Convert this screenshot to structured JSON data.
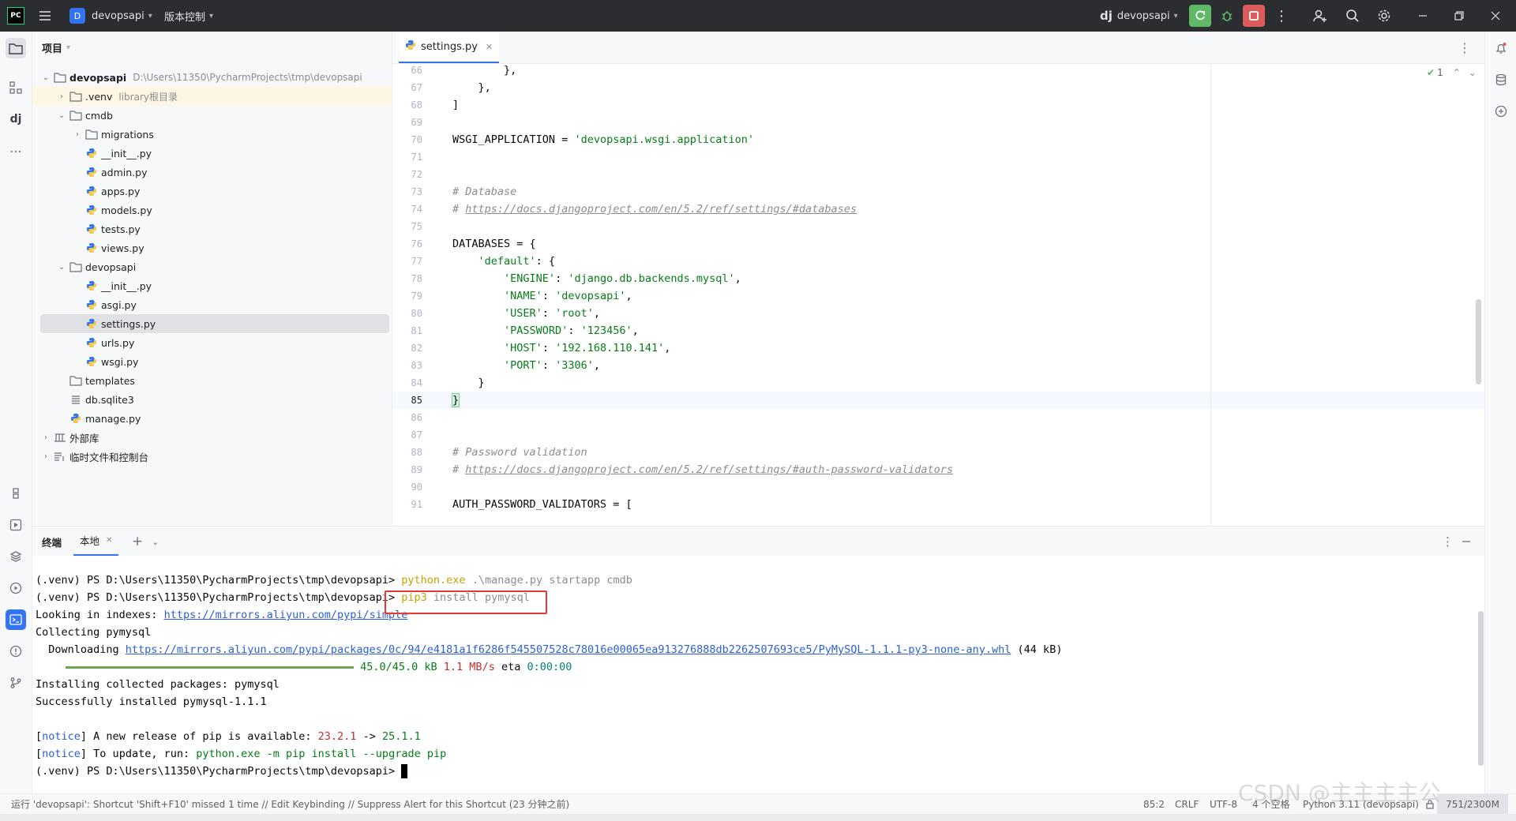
{
  "titlebar": {
    "app_icon": "PC",
    "project_badge": "D",
    "project_name": "devopsapi",
    "vcs_label": "版本控制",
    "run_config_logo": "dj",
    "run_config": "devopsapi"
  },
  "project_panel": {
    "title": "项目",
    "tree": [
      {
        "label": "devopsapi",
        "extra": "D:\\Users\\11350\\PycharmProjects\\tmp\\devopsapi",
        "icon": "folder-icon",
        "depth": 0,
        "arrow": "down",
        "bold": true
      },
      {
        "label": ".venv",
        "extra": "library根目录",
        "icon": "folder-icon",
        "depth": 1,
        "arrow": "right"
      },
      {
        "label": "cmdb",
        "extra": "",
        "icon": "folder-icon",
        "depth": 1,
        "arrow": "down"
      },
      {
        "label": "migrations",
        "extra": "",
        "icon": "folder-icon",
        "depth": 2,
        "arrow": "right"
      },
      {
        "label": "__init__.py",
        "extra": "",
        "icon": "python-file-icon",
        "depth": 2,
        "arrow": ""
      },
      {
        "label": "admin.py",
        "extra": "",
        "icon": "python-file-icon",
        "depth": 2,
        "arrow": ""
      },
      {
        "label": "apps.py",
        "extra": "",
        "icon": "python-file-icon",
        "depth": 2,
        "arrow": ""
      },
      {
        "label": "models.py",
        "extra": "",
        "icon": "python-file-icon",
        "depth": 2,
        "arrow": ""
      },
      {
        "label": "tests.py",
        "extra": "",
        "icon": "python-file-icon",
        "depth": 2,
        "arrow": ""
      },
      {
        "label": "views.py",
        "extra": "",
        "icon": "python-file-icon",
        "depth": 2,
        "arrow": ""
      },
      {
        "label": "devopsapi",
        "extra": "",
        "icon": "folder-icon",
        "depth": 1,
        "arrow": "down"
      },
      {
        "label": "__init__.py",
        "extra": "",
        "icon": "python-file-icon",
        "depth": 2,
        "arrow": ""
      },
      {
        "label": "asgi.py",
        "extra": "",
        "icon": "python-file-icon",
        "depth": 2,
        "arrow": ""
      },
      {
        "label": "settings.py",
        "extra": "",
        "icon": "python-file-icon",
        "depth": 2,
        "arrow": "",
        "selected": true
      },
      {
        "label": "urls.py",
        "extra": "",
        "icon": "python-file-icon",
        "depth": 2,
        "arrow": ""
      },
      {
        "label": "wsgi.py",
        "extra": "",
        "icon": "python-file-icon",
        "depth": 2,
        "arrow": ""
      },
      {
        "label": "templates",
        "extra": "",
        "icon": "folder-icon",
        "depth": 1,
        "arrow": ""
      },
      {
        "label": "db.sqlite3",
        "extra": "",
        "icon": "database-file-icon",
        "depth": 1,
        "arrow": ""
      },
      {
        "label": "manage.py",
        "extra": "",
        "icon": "python-file-icon",
        "depth": 1,
        "arrow": ""
      },
      {
        "label": "外部库",
        "extra": "",
        "icon": "library-icon",
        "depth": 0,
        "arrow": "right"
      },
      {
        "label": "临时文件和控制台",
        "extra": "",
        "icon": "scratches-icon",
        "depth": 0,
        "arrow": "right"
      }
    ]
  },
  "editor": {
    "tab_label": "settings.py",
    "inspection_count": "1",
    "lines": [
      {
        "n": "66",
        "parts": [
          {
            "t": "        },",
            "c": ""
          }
        ]
      },
      {
        "n": "67",
        "parts": [
          {
            "t": "    },",
            "c": ""
          }
        ]
      },
      {
        "n": "68",
        "parts": [
          {
            "t": "]",
            "c": ""
          }
        ]
      },
      {
        "n": "69",
        "parts": [
          {
            "t": "",
            "c": ""
          }
        ]
      },
      {
        "n": "70",
        "parts": [
          {
            "t": "WSGI_APPLICATION = ",
            "c": ""
          },
          {
            "t": "'devopsapi.wsgi.application'",
            "c": "str"
          }
        ]
      },
      {
        "n": "71",
        "parts": [
          {
            "t": "",
            "c": ""
          }
        ]
      },
      {
        "n": "72",
        "parts": [
          {
            "t": "",
            "c": ""
          }
        ]
      },
      {
        "n": "73",
        "parts": [
          {
            "t": "# Database",
            "c": "cmt"
          }
        ]
      },
      {
        "n": "74",
        "parts": [
          {
            "t": "# ",
            "c": "cmt"
          },
          {
            "t": "https://docs.djangoproject.com/en/5.2/ref/settings/#databases",
            "c": "lnk"
          }
        ]
      },
      {
        "n": "75",
        "parts": [
          {
            "t": "",
            "c": ""
          }
        ]
      },
      {
        "n": "76",
        "parts": [
          {
            "t": "DATABASES = {",
            "c": ""
          }
        ]
      },
      {
        "n": "77",
        "parts": [
          {
            "t": "    ",
            "c": ""
          },
          {
            "t": "'default'",
            "c": "str"
          },
          {
            "t": ": {",
            "c": ""
          }
        ]
      },
      {
        "n": "78",
        "parts": [
          {
            "t": "        ",
            "c": ""
          },
          {
            "t": "'ENGINE'",
            "c": "str"
          },
          {
            "t": ": ",
            "c": ""
          },
          {
            "t": "'django.db.backends.mysql'",
            "c": "str"
          },
          {
            "t": ",",
            "c": ""
          }
        ]
      },
      {
        "n": "79",
        "parts": [
          {
            "t": "        ",
            "c": ""
          },
          {
            "t": "'NAME'",
            "c": "str"
          },
          {
            "t": ": ",
            "c": ""
          },
          {
            "t": "'devopsapi'",
            "c": "str"
          },
          {
            "t": ",",
            "c": ""
          }
        ]
      },
      {
        "n": "80",
        "parts": [
          {
            "t": "        ",
            "c": ""
          },
          {
            "t": "'USER'",
            "c": "str"
          },
          {
            "t": ": ",
            "c": ""
          },
          {
            "t": "'root'",
            "c": "str"
          },
          {
            "t": ",",
            "c": ""
          }
        ]
      },
      {
        "n": "81",
        "parts": [
          {
            "t": "        ",
            "c": ""
          },
          {
            "t": "'PASSWORD'",
            "c": "str"
          },
          {
            "t": ": ",
            "c": ""
          },
          {
            "t": "'123456'",
            "c": "str"
          },
          {
            "t": ",",
            "c": ""
          }
        ]
      },
      {
        "n": "82",
        "parts": [
          {
            "t": "        ",
            "c": ""
          },
          {
            "t": "'HOST'",
            "c": "str"
          },
          {
            "t": ": ",
            "c": ""
          },
          {
            "t": "'192.168.110.141'",
            "c": "str"
          },
          {
            "t": ",",
            "c": ""
          }
        ]
      },
      {
        "n": "83",
        "parts": [
          {
            "t": "        ",
            "c": ""
          },
          {
            "t": "'PORT'",
            "c": "str"
          },
          {
            "t": ": ",
            "c": ""
          },
          {
            "t": "'3306'",
            "c": "str"
          },
          {
            "t": ",",
            "c": ""
          }
        ]
      },
      {
        "n": "84",
        "parts": [
          {
            "t": "    }",
            "c": ""
          }
        ]
      },
      {
        "n": "85",
        "parts": [
          {
            "t": "}",
            "c": ""
          }
        ],
        "current": true
      },
      {
        "n": "86",
        "parts": [
          {
            "t": "",
            "c": ""
          }
        ]
      },
      {
        "n": "87",
        "parts": [
          {
            "t": "",
            "c": ""
          }
        ]
      },
      {
        "n": "88",
        "parts": [
          {
            "t": "# Password validation",
            "c": "cmt"
          }
        ]
      },
      {
        "n": "89",
        "parts": [
          {
            "t": "# ",
            "c": "cmt"
          },
          {
            "t": "https://docs.djangoproject.com/en/5.2/ref/settings/#auth-password-validators",
            "c": "lnk"
          }
        ]
      },
      {
        "n": "90",
        "parts": [
          {
            "t": "",
            "c": ""
          }
        ]
      },
      {
        "n": "91",
        "parts": [
          {
            "t": "AUTH_PASSWORD_VALIDATORS = [",
            "c": ""
          }
        ]
      }
    ]
  },
  "terminal": {
    "tab_terminal": "终端",
    "tab_local": "本地",
    "lines": [
      {
        "parts": [
          {
            "t": "(.venv) PS D:\\Users\\11350\\PycharmProjects\\tmp\\devopsapi> ",
            "c": ""
          },
          {
            "t": "python.exe",
            "c": "yel"
          },
          {
            "t": " .\\manage.py startapp cmdb",
            "c": "gry"
          }
        ]
      },
      {
        "parts": [
          {
            "t": "(.venv) PS D:\\Users\\11350\\PycharmProjects\\tmp\\devopsapi> ",
            "c": ""
          },
          {
            "t": "pip3",
            "c": "yel"
          },
          {
            "t": " install pymysql",
            "c": "gry"
          }
        ]
      },
      {
        "parts": [
          {
            "t": "Looking in indexes: ",
            "c": ""
          },
          {
            "t": "https://mirrors.aliyun.com/pypi/simple",
            "c": "blu"
          }
        ]
      },
      {
        "parts": [
          {
            "t": "Collecting pymysql",
            "c": ""
          }
        ]
      },
      {
        "parts": [
          {
            "t": "  Downloading ",
            "c": ""
          },
          {
            "t": "https://mirrors.aliyun.com/pypi/packages/0c/94/e4181a1f6286f545507528c78016e00065ea913276888db2262507693ce5/PyMySQL-1.1.1-py3-none-any.whl",
            "c": "blu"
          },
          {
            "t": " (44 kB)",
            "c": ""
          }
        ]
      },
      {
        "parts": [
          {
            "t": "                                          ",
            "c": "bar"
          },
          {
            "t": " 45.0/45.0 kB ",
            "c": "grn"
          },
          {
            "t": "1.1 MB/s",
            "c": "red"
          },
          {
            "t": " eta ",
            "c": ""
          },
          {
            "t": "0:00:00",
            "c": "teal"
          }
        ]
      },
      {
        "parts": [
          {
            "t": "Installing collected packages: pymysql",
            "c": ""
          }
        ]
      },
      {
        "parts": [
          {
            "t": "Successfully installed pymysql-1.1.1",
            "c": ""
          }
        ]
      },
      {
        "parts": [
          {
            "t": "",
            "c": ""
          }
        ]
      },
      {
        "parts": [
          {
            "t": "[",
            "c": ""
          },
          {
            "t": "notice",
            "c": "nb"
          },
          {
            "t": "] A new release of pip is available: ",
            "c": ""
          },
          {
            "t": "23.2.1",
            "c": "red"
          },
          {
            "t": " -> ",
            "c": ""
          },
          {
            "t": "25.1.1",
            "c": "grn"
          }
        ]
      },
      {
        "parts": [
          {
            "t": "[",
            "c": ""
          },
          {
            "t": "notice",
            "c": "nb"
          },
          {
            "t": "] To update, run: ",
            "c": ""
          },
          {
            "t": "python.exe -m pip install --upgrade pip",
            "c": "grn"
          }
        ]
      },
      {
        "parts": [
          {
            "t": "(.venv) PS D:\\Users\\11350\\PycharmProjects\\tmp\\devopsapi> ",
            "c": ""
          }
        ]
      }
    ]
  },
  "statusbar": {
    "message": "运行 'devopsapi': Shortcut 'Shift+F10' missed 1 time // Edit Keybinding // Suppress Alert for this Shortcut (23 分钟之前)",
    "position": "85:2",
    "line_ending": "CRLF",
    "encoding": "UTF-8",
    "indent": "4 个空格",
    "interpreter": "Python 3.11 (devopsapi)",
    "memory": "751/2300M",
    "watermark": "CSDN @主主主主公"
  },
  "colors": {
    "accent": "#3574f0",
    "run_green": "#5fb865",
    "stop_red": "#db5c5c",
    "highlight_box": "#e53935"
  }
}
